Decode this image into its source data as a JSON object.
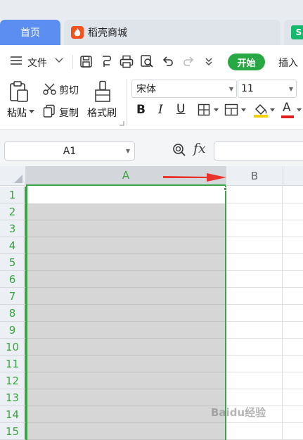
{
  "tabs": {
    "home_label": "首页",
    "store_label": "稻壳商城",
    "extra_label": "S"
  },
  "menu": {
    "file_label": "文件",
    "start_label": "开始",
    "insert_label": "插入"
  },
  "clipboard": {
    "paste_label": "粘贴",
    "cut_label": "剪切",
    "copy_label": "复制",
    "format_painter_label": "格式刷"
  },
  "font": {
    "family": "宋体",
    "size": "11",
    "bold_label": "B",
    "italic_label": "I",
    "underline_label": "U",
    "font_color_label": "A",
    "font_color": "#e02020",
    "fill_color": "#f5d000"
  },
  "formula_bar": {
    "cell_ref": "A1",
    "fx_label": "fx",
    "value": ""
  },
  "grid": {
    "columns": [
      "A",
      "B"
    ],
    "rows": [
      "1",
      "2",
      "3",
      "4",
      "5",
      "6",
      "7",
      "8",
      "9",
      "10",
      "11",
      "12",
      "13",
      "14",
      "15"
    ],
    "selected_column": "A",
    "selection_color": "#3aa343"
  },
  "annotation": {
    "arrow_color": "#e8322a"
  },
  "watermark": {
    "text": "Baidu经验"
  },
  "colors": {
    "accent_tab": "#5b8ef0",
    "start_button": "#28a745",
    "store_icon": "#f0531e",
    "extra_tab_icon": "#16b96c"
  }
}
